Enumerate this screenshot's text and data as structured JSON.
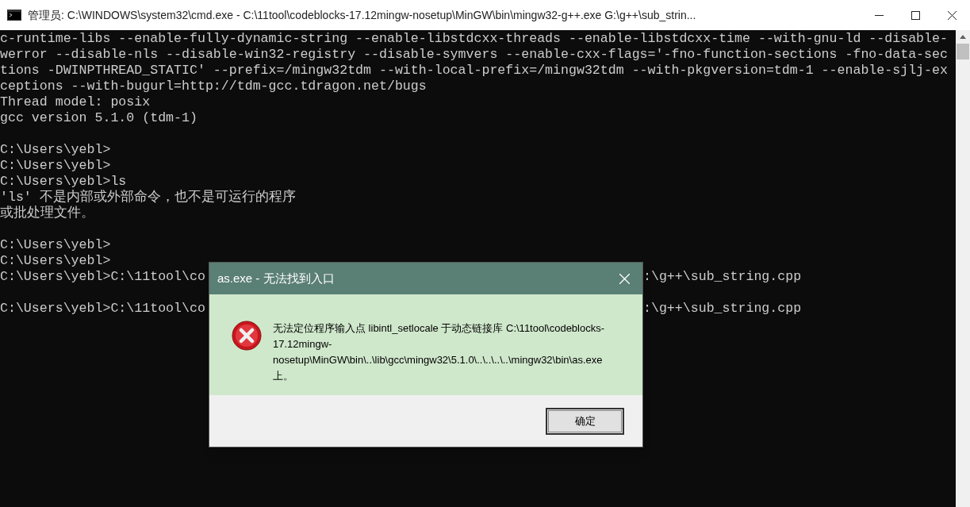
{
  "window": {
    "title": "管理员: C:\\WINDOWS\\system32\\cmd.exe - C:\\11tool\\codeblocks-17.12mingw-nosetup\\MinGW\\bin\\mingw32-g++.exe  G:\\g++\\sub_strin..."
  },
  "console": {
    "lines": [
      {
        "kind": "text",
        "text": "c-runtime-libs --enable-fully-dynamic-string --enable-libstdcxx-threads --enable-libstdcxx-time --with-gnu-ld --disable-"
      },
      {
        "kind": "text",
        "text": "werror --disable-nls --disable-win32-registry --disable-symvers --enable-cxx-flags='-fno-function-sections -fno-data-sec"
      },
      {
        "kind": "text",
        "text": "tions -DWINPTHREAD_STATIC' --prefix=/mingw32tdm --with-local-prefix=/mingw32tdm --with-pkgversion=tdm-1 --enable-sjlj-ex"
      },
      {
        "kind": "text",
        "text": "ceptions --with-bugurl=http://tdm-gcc.tdragon.net/bugs"
      },
      {
        "kind": "text",
        "text": "Thread model: posix"
      },
      {
        "kind": "text",
        "text": "gcc version 5.1.0 (tdm-1)"
      },
      {
        "kind": "blank"
      },
      {
        "kind": "text",
        "text": "C:\\Users\\yebl>"
      },
      {
        "kind": "text",
        "text": "C:\\Users\\yebl>"
      },
      {
        "kind": "text",
        "text": "C:\\Users\\yebl>ls"
      },
      {
        "kind": "text",
        "text": "'ls' 不是内部或外部命令，也不是可运行的程序"
      },
      {
        "kind": "text",
        "text": "或批处理文件。"
      },
      {
        "kind": "blank"
      },
      {
        "kind": "text",
        "text": "C:\\Users\\yebl>"
      },
      {
        "kind": "text",
        "text": "C:\\Users\\yebl>"
      },
      {
        "kind": "split",
        "text": "C:\\Users\\yebl>C:\\11tool\\co",
        "text_right": ":\\g++\\sub_string.cpp"
      },
      {
        "kind": "blank"
      },
      {
        "kind": "split",
        "text": "C:\\Users\\yebl>C:\\11tool\\co",
        "text_right": ":\\g++\\sub_string.cpp"
      }
    ]
  },
  "dialog": {
    "title": "as.exe - 无法找到入口",
    "message": "无法定位程序输入点 libintl_setlocale 于动态链接库 C:\\11tool\\codeblocks-17.12mingw-nosetup\\MinGW\\bin\\..\\lib\\gcc\\mingw32\\5.1.0\\..\\..\\..\\..\\mingw32\\bin\\as.exe 上。",
    "button": "确定"
  }
}
